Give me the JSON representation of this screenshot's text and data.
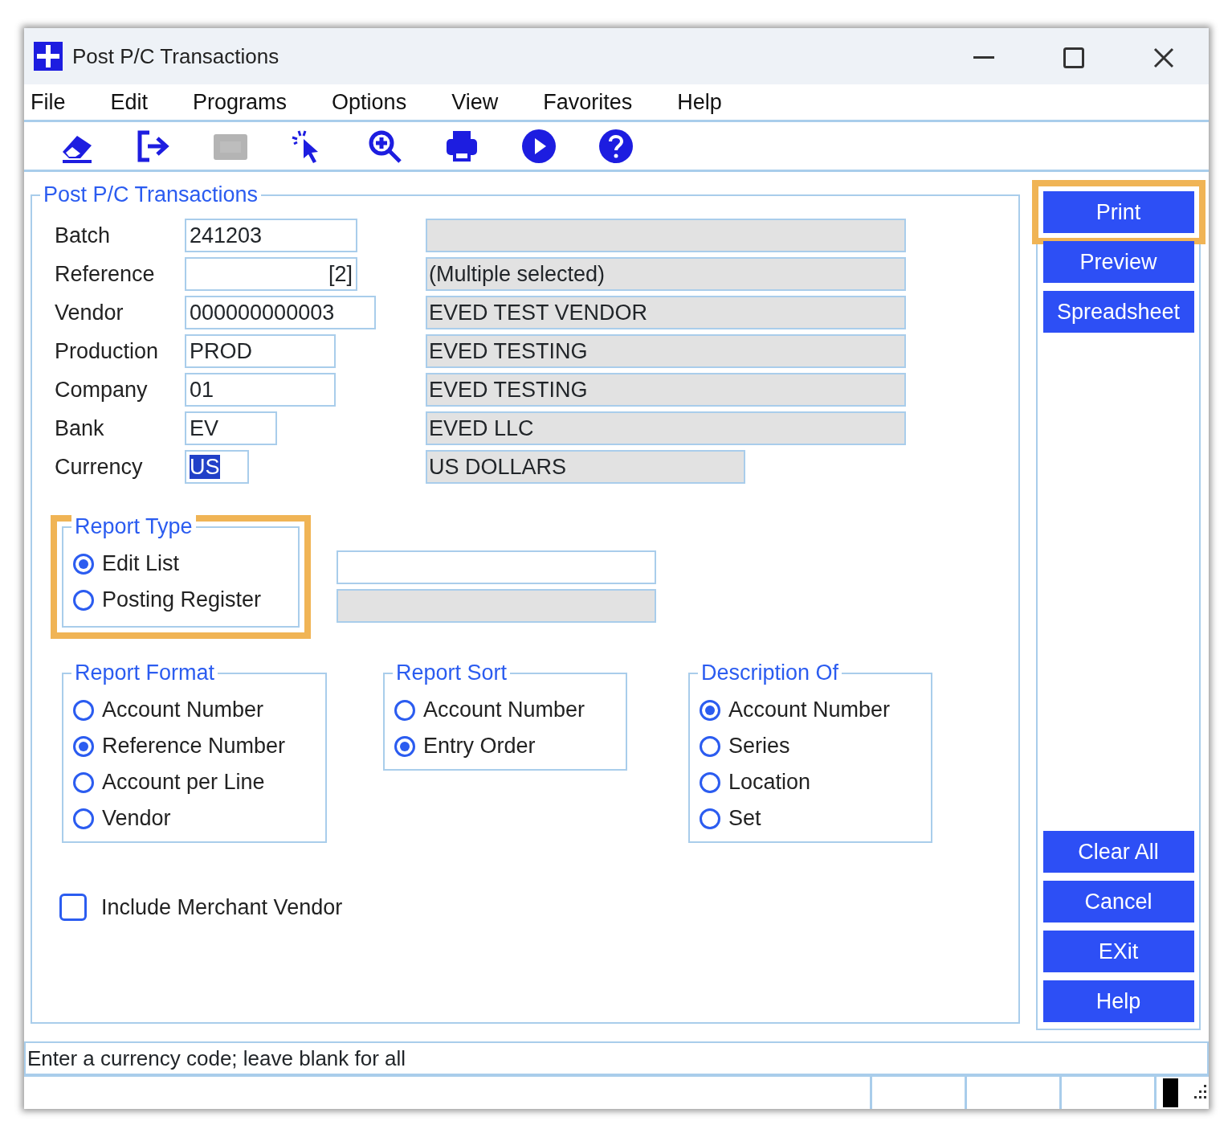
{
  "window": {
    "title": "Post P/C Transactions"
  },
  "menu": [
    "File",
    "Edit",
    "Programs",
    "Options",
    "View",
    "Favorites",
    "Help"
  ],
  "toolbar": [
    {
      "kind": "eraser",
      "disabled": false
    },
    {
      "kind": "exit",
      "disabled": false
    },
    {
      "kind": "window",
      "disabled": true
    },
    {
      "kind": "pointer",
      "disabled": false
    },
    {
      "kind": "zoom",
      "disabled": false
    },
    {
      "kind": "printer",
      "disabled": false
    },
    {
      "kind": "play",
      "disabled": false
    },
    {
      "kind": "help",
      "disabled": false
    }
  ],
  "form": {
    "title": "Post P/C Transactions",
    "fields": [
      {
        "label": "Batch",
        "value": "241203",
        "text_selected": false
      },
      {
        "label": "Reference",
        "value": "[2]",
        "text_selected": false,
        "description": "(Multiple selected)"
      },
      {
        "label": "Vendor",
        "value": "000000000003",
        "text_selected": false,
        "description": "EVED TEST VENDOR"
      },
      {
        "label": "Production",
        "value": "PROD",
        "text_selected": false,
        "description": "EVED TESTING"
      },
      {
        "label": "Company",
        "value": "01",
        "text_selected": false,
        "description": "EVED TESTING"
      },
      {
        "label": "Bank",
        "value": "EV",
        "text_selected": false,
        "description": "EVED LLC"
      },
      {
        "label": "Currency",
        "value": "US",
        "text_selected": true,
        "description": "US DOLLARS"
      }
    ],
    "report_type": {
      "title": "Report Type",
      "highlighted": true,
      "options": [
        {
          "label": "Edit List",
          "selected": true
        },
        {
          "label": "Posting Register",
          "selected": false
        }
      ]
    },
    "extra_fields": [
      {
        "kind": "input"
      },
      {
        "kind": "readonly"
      }
    ],
    "groups": [
      {
        "title": "Report Format",
        "options": [
          {
            "label": "Account Number",
            "selected": false
          },
          {
            "label": "Reference Number",
            "selected": true
          },
          {
            "label": "Account per Line",
            "selected": false
          },
          {
            "label": "Vendor",
            "selected": false
          }
        ]
      },
      {
        "title": "Report Sort",
        "options": [
          {
            "label": "Account Number",
            "selected": false
          },
          {
            "label": "Entry Order",
            "selected": true
          }
        ]
      },
      {
        "title": "Description Of",
        "options": [
          {
            "label": "Account Number",
            "selected": true
          },
          {
            "label": "Series",
            "selected": false
          },
          {
            "label": "Location",
            "selected": false
          },
          {
            "label": "Set",
            "selected": false
          }
        ]
      }
    ],
    "checkbox": {
      "label": "Include Merchant Vendor",
      "checked": false
    }
  },
  "buttons_top": [
    {
      "label": "Print",
      "highlighted": true
    },
    {
      "label": "Preview",
      "highlighted": false
    },
    {
      "label": "Spreadsheet",
      "highlighted": false
    }
  ],
  "buttons_bottom": [
    {
      "label": "Clear All",
      "highlighted": false
    },
    {
      "label": "Cancel",
      "highlighted": false
    },
    {
      "label": "EXit",
      "highlighted": false
    },
    {
      "label": "Help",
      "highlighted": false
    }
  ],
  "status_bar": {
    "message": "Enter a currency code; leave blank for all"
  }
}
